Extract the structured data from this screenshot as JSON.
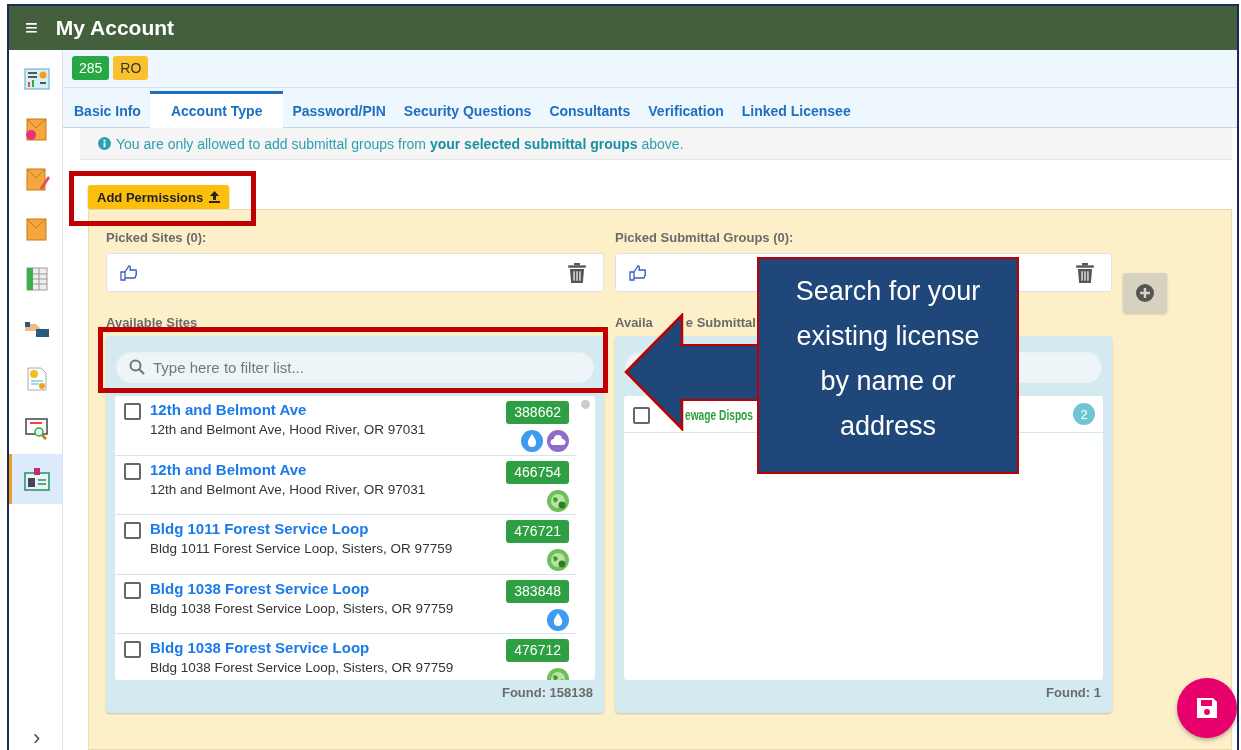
{
  "header": {
    "menu_glyph": "≡",
    "title": "My Account"
  },
  "sidebar": {
    "items": [
      {
        "kind": "dashboard",
        "selected": false
      },
      {
        "kind": "envelope-new",
        "selected": false
      },
      {
        "kind": "envelope-pencil",
        "selected": false
      },
      {
        "kind": "envelope",
        "selected": false
      },
      {
        "kind": "spreadsheet",
        "selected": false
      },
      {
        "kind": "hand-card",
        "selected": false
      },
      {
        "kind": "certificate",
        "selected": false
      },
      {
        "kind": "monitor-search",
        "selected": false
      },
      {
        "kind": "id-card",
        "selected": true
      }
    ],
    "expand_glyph": "›"
  },
  "badges": [
    {
      "label": "285",
      "color": "#28a745"
    },
    {
      "label": "RO",
      "color": "#fbc02d"
    }
  ],
  "tabs": [
    {
      "label": "Basic Info",
      "selected": false
    },
    {
      "label": "Account Type",
      "selected": true
    },
    {
      "label": "Password/PIN",
      "selected": false
    },
    {
      "label": "Security Questions",
      "selected": false
    },
    {
      "label": "Consultants",
      "selected": false
    },
    {
      "label": "Verification",
      "selected": false
    },
    {
      "label": "Linked Licensee",
      "selected": false
    }
  ],
  "info": "You are only allowed to add submittal groups from **your selected submittal groups** above.",
  "add_button": "Add Permissions",
  "sites": {
    "picked_label": "Picked Sites (0):",
    "available_label": "Available Sites",
    "search_placeholder": "Type here to filter list...",
    "found": "Found: 158138",
    "rows": [
      {
        "name": "12th and Belmont Ave",
        "address": "12th and Belmont Ave, Hood River, OR 97031",
        "number": "388662",
        "checked": false,
        "icons": [
          {
            "kind": "water"
          },
          {
            "kind": "cloud"
          }
        ]
      },
      {
        "name": "12th and Belmont Ave",
        "address": "12th and Belmont Ave, Hood River, OR 97031",
        "number": "466754",
        "checked": false,
        "icons": [
          {
            "kind": "globe"
          }
        ]
      },
      {
        "name": "Bldg 1011 Forest Service Loop",
        "address": "Bldg 1011 Forest Service Loop, Sisters, OR 97759",
        "number": "476721",
        "checked": false,
        "icons": [
          {
            "kind": "globe"
          }
        ]
      },
      {
        "name": "Bldg 1038 Forest Service Loop",
        "address": "Bldg 1038 Forest Service Loop, Sisters, OR 97759",
        "number": "383848",
        "checked": false,
        "icons": [
          {
            "kind": "water"
          }
        ]
      },
      {
        "name": "Bldg 1038 Forest Service Loop",
        "address": "Bldg 1038 Forest Service Loop, Sisters, OR 97759",
        "number": "476712",
        "checked": false,
        "icons": [
          {
            "kind": "globe"
          }
        ]
      }
    ]
  },
  "groups": {
    "picked_label": "Picked Submittal Groups (0):",
    "available_label_parts": [
      "Availa",
      "e Submittal"
    ],
    "found": "Found: 1",
    "rows": [
      {
        "name": "ewage Dispos",
        "count": "2",
        "checked": false
      }
    ]
  },
  "callout": "Search for your existing license by name or address"
}
